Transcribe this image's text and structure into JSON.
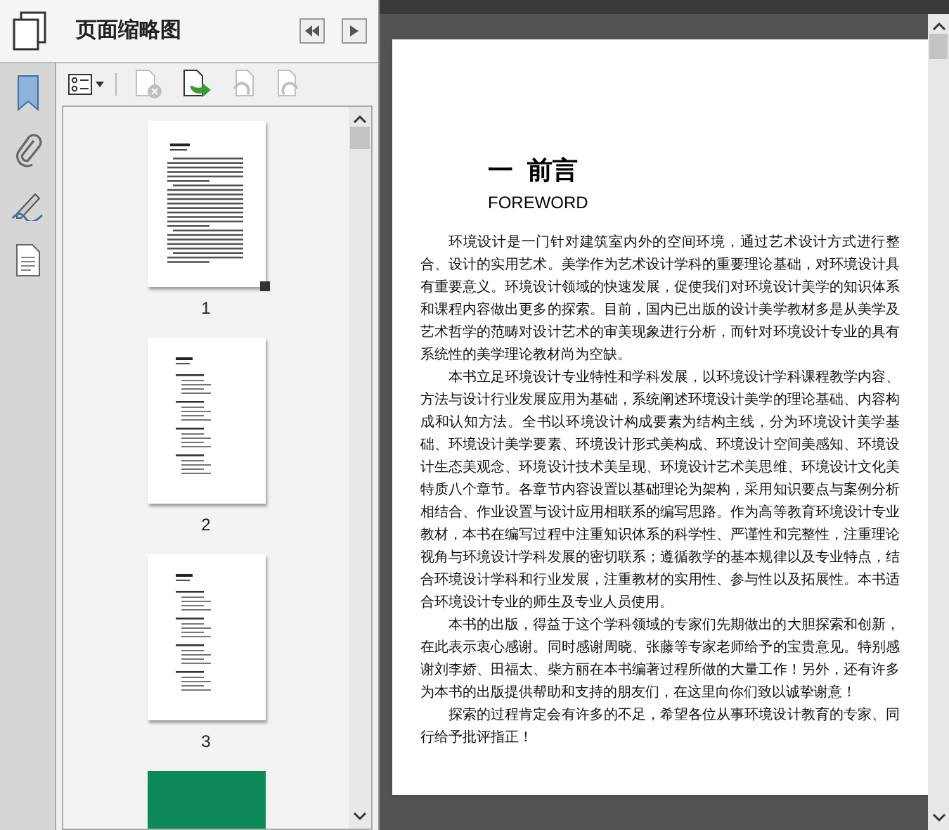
{
  "panel": {
    "title": "页面缩略图",
    "toolbar": [
      {
        "kind": "options",
        "disabled": false
      },
      {
        "kind": "delete",
        "disabled": true
      },
      {
        "kind": "insert",
        "disabled": false
      },
      {
        "kind": "rotate-left",
        "disabled": true
      },
      {
        "kind": "rotate-right",
        "disabled": true
      }
    ]
  },
  "thumbnails": [
    {
      "number": "1",
      "kind": "text",
      "selected": true
    },
    {
      "number": "2",
      "kind": "contents",
      "selected": false
    },
    {
      "number": "3",
      "kind": "contents",
      "selected": false
    },
    {
      "kind": "cover",
      "selected": false
    }
  ],
  "page": {
    "heading": "一  前言",
    "subheading": "FOREWORD",
    "paragraphs": [
      "环境设计是一门针对建筑室内外的空间环境，通过艺术设计方式进行整合、设计的实用艺术。美学作为艺术设计学科的重要理论基础，对环境设计具有重要意义。环境设计领域的快速发展，促使我们对环境设计美学的知识体系和课程内容做出更多的探索。目前，国内已出版的设计美学教材多是从美学及艺术哲学的范畴对设计艺术的审美现象进行分析，而针对环境设计专业的具有系统性的美学理论教材尚为空缺。",
      "本书立足环境设计专业特性和学科发展，以环境设计学科课程教学内容、方法与设计行业发展应用为基础，系统阐述环境设计美学的理论基础、内容构成和认知方法。全书以环境设计构成要素为结构主线，分为环境设计美学基础、环境设计美学要素、环境设计形式美构成、环境设计空间美感知、环境设计生态美观念、环境设计技术美呈现、环境设计艺术美思维、环境设计文化美特质八个章节。各章节内容设置以基础理论为架构，采用知识要点与案例分析相结合、作业设置与设计应用相联系的编写思路。作为高等教育环境设计专业教材，本书在编写过程中注重知识体系的科学性、严谨性和完整性，注重理论视角与环境设计学科发展的密切联系；遵循教学的基本规律以及专业特点，结合环境设计学科和行业发展，注重教材的实用性、参与性以及拓展性。本书适合环境设计专业的师生及专业人员使用。",
      "本书的出版，得益于这个学科领域的专家们先期做出的大胆探索和创新，在此表示衷心感谢。同时感谢周晓、张藤等专家老师给予的宝贵意见。特别感谢刘李娇、田福太、柴方丽在本书编著过程所做的大量工作！另外，还有许多为本书的出版提供帮助和支持的朋友们，在这里向你们致以诚挚谢意！",
      "探索的过程肯定会有许多的不足，希望各位从事环境设计教育的专家、同行给予批评指正！"
    ]
  }
}
